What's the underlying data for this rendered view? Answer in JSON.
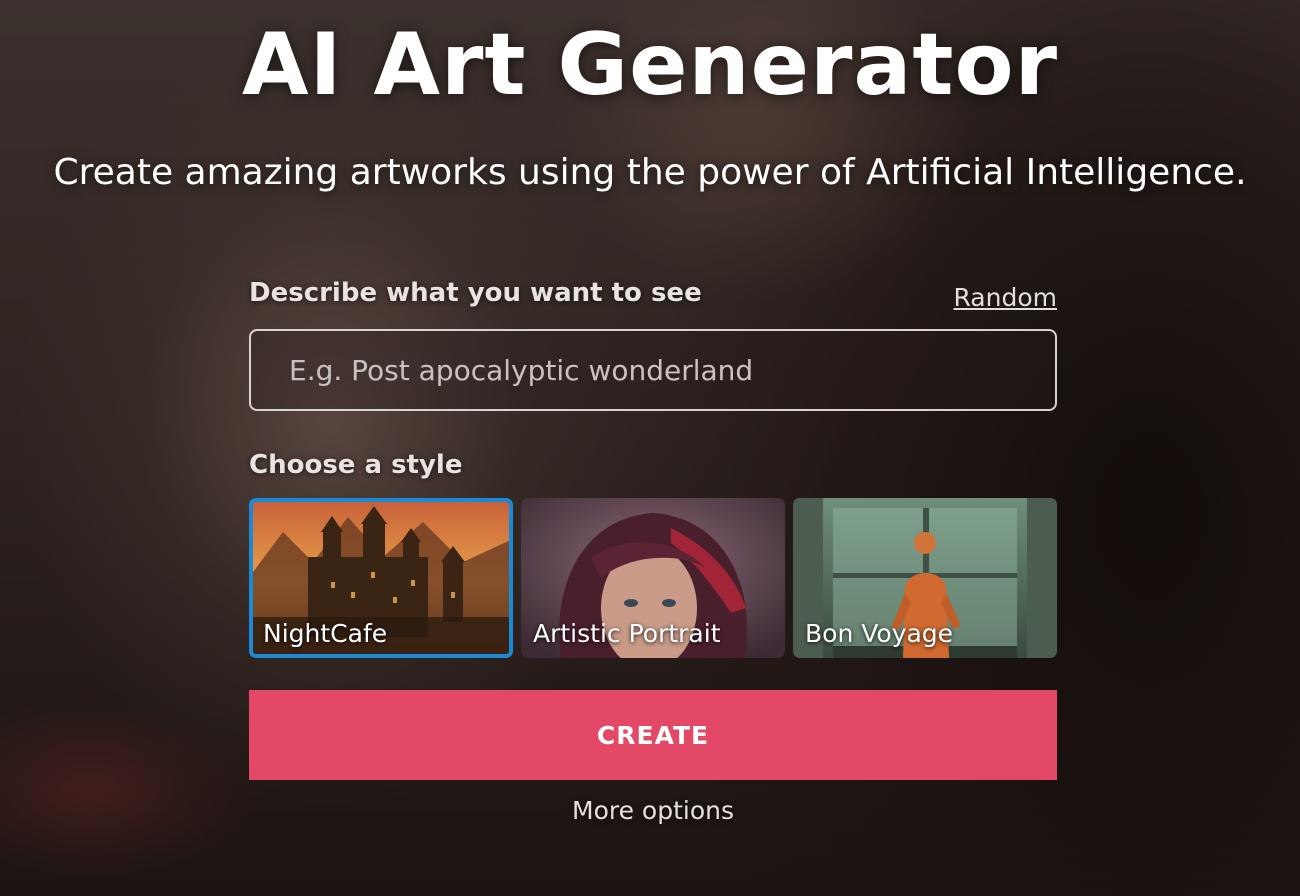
{
  "hero": {
    "title": "AI Art Generator",
    "subtitle": "Create amazing artworks using the power of Artificial Intelligence."
  },
  "prompt": {
    "label": "Describe what you want to see",
    "random_link": "Random",
    "placeholder": "E.g. Post apocalyptic wonderland",
    "value": ""
  },
  "styles": {
    "label": "Choose a style",
    "items": [
      {
        "name": "NightCafe",
        "selected": true
      },
      {
        "name": "Artistic Portrait",
        "selected": false
      },
      {
        "name": "Bon Voyage",
        "selected": false
      }
    ]
  },
  "actions": {
    "create_label": "CREATE",
    "more_options_label": "More options"
  },
  "colors": {
    "accent": "#e34967",
    "selected_border": "#1a8ad6"
  }
}
